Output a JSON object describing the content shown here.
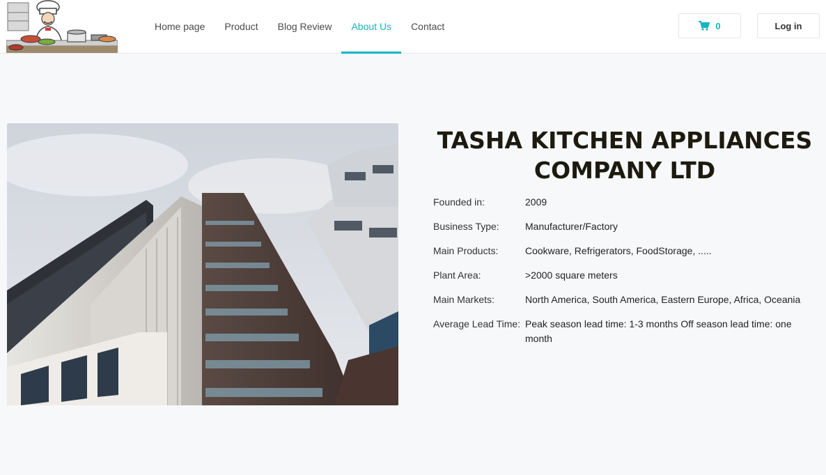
{
  "header": {
    "logo_name": "chef-logo",
    "nav": [
      {
        "label": "Home page",
        "active": false
      },
      {
        "label": "Product",
        "active": false
      },
      {
        "label": "Blog Review",
        "active": false
      },
      {
        "label": "About Us",
        "active": true
      },
      {
        "label": "Contact",
        "active": false
      }
    ],
    "cart_count": "0",
    "login_label": "Log in",
    "accent_color": "#17b3c4"
  },
  "company": {
    "title": "TASHA KITCHEN APPLIANCES COMPANY LTD",
    "details": [
      {
        "label": "Founded in:",
        "value": "2009"
      },
      {
        "label": "Business Type:",
        "value": "Manufacturer/Factory"
      },
      {
        "label": "Main Products:",
        "value": "Cookware, Refrigerators, FoodStorage, ....."
      },
      {
        "label": "Plant Area:",
        "value": ">2000 square meters"
      },
      {
        "label": "Main Markets:",
        "value": "North America, South America, Eastern Europe, Africa, Oceania"
      },
      {
        "label": "Average Lead Time:",
        "value": "Peak season lead time: 1-3 months Off season lead time: one month"
      }
    ]
  },
  "icons": {
    "cart": "shopping-cart-icon"
  }
}
